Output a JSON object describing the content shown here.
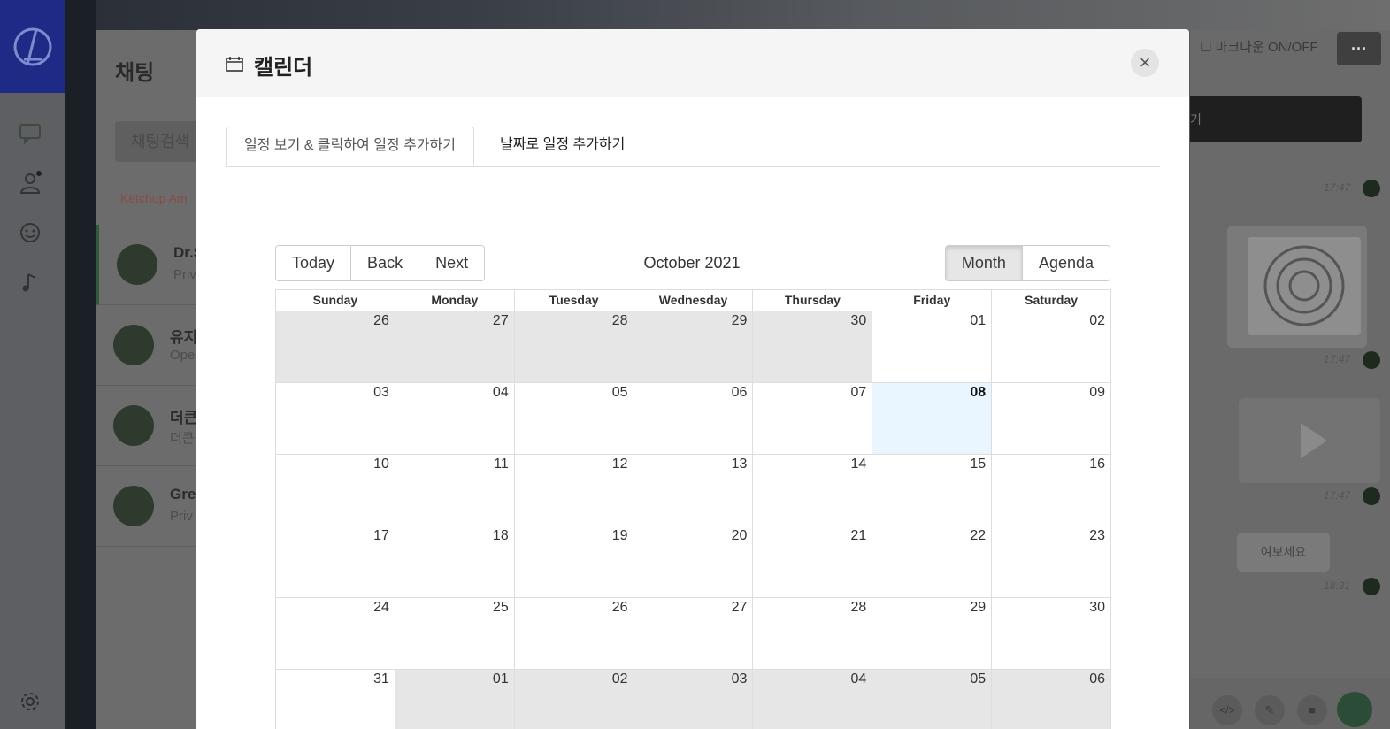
{
  "background": {
    "chat_title": "채팅",
    "chat_search_placeholder": "채팅검색",
    "chat_group_label": "Ketchup Am",
    "chats": [
      {
        "name": "Dr.S",
        "sub": "Priv"
      },
      {
        "name": "유지",
        "sub": "Ope"
      },
      {
        "name": "더큰",
        "sub": "더큰"
      },
      {
        "name": "Gre",
        "sub": "Priv"
      }
    ],
    "markdown_toggle": "마크다운 ON/OFF",
    "more_label": "···",
    "dark_bar_text": "기",
    "timestamps": [
      "17:47",
      "17:47",
      "17:47",
      "18:31"
    ],
    "message_text": "여보세요"
  },
  "modal": {
    "title": "캘린더",
    "close_label": "×",
    "tabs": [
      {
        "label": "일정 보기 & 클릭하여 일정 추가하기",
        "active": true
      },
      {
        "label": "날짜로 일정 추가하기",
        "active": false
      }
    ]
  },
  "calendar": {
    "nav": {
      "today": "Today",
      "back": "Back",
      "next": "Next"
    },
    "label": "October 2021",
    "views": {
      "month": "Month",
      "agenda": "Agenda",
      "active": "Month"
    },
    "weekdays": [
      "Sunday",
      "Monday",
      "Tuesday",
      "Wednesday",
      "Thursday",
      "Friday",
      "Saturday"
    ],
    "weeks": [
      [
        {
          "d": "26",
          "off": true
        },
        {
          "d": "27",
          "off": true
        },
        {
          "d": "28",
          "off": true
        },
        {
          "d": "29",
          "off": true
        },
        {
          "d": "30",
          "off": true
        },
        {
          "d": "01"
        },
        {
          "d": "02"
        }
      ],
      [
        {
          "d": "03"
        },
        {
          "d": "04"
        },
        {
          "d": "05"
        },
        {
          "d": "06"
        },
        {
          "d": "07"
        },
        {
          "d": "08",
          "today": true
        },
        {
          "d": "09"
        }
      ],
      [
        {
          "d": "10"
        },
        {
          "d": "11"
        },
        {
          "d": "12"
        },
        {
          "d": "13"
        },
        {
          "d": "14"
        },
        {
          "d": "15"
        },
        {
          "d": "16"
        }
      ],
      [
        {
          "d": "17"
        },
        {
          "d": "18"
        },
        {
          "d": "19"
        },
        {
          "d": "20"
        },
        {
          "d": "21"
        },
        {
          "d": "22"
        },
        {
          "d": "23"
        }
      ],
      [
        {
          "d": "24"
        },
        {
          "d": "25"
        },
        {
          "d": "26"
        },
        {
          "d": "27"
        },
        {
          "d": "28"
        },
        {
          "d": "29"
        },
        {
          "d": "30"
        }
      ],
      [
        {
          "d": "31"
        },
        {
          "d": "01",
          "off": true
        },
        {
          "d": "02",
          "off": true
        },
        {
          "d": "03",
          "off": true
        },
        {
          "d": "04",
          "off": true
        },
        {
          "d": "05",
          "off": true
        },
        {
          "d": "06",
          "off": true
        }
      ]
    ]
  },
  "colors": {
    "today_bg": "#eaf6ff",
    "off_range_bg": "#e6e6e6",
    "logo_bg": "#1e2a86"
  }
}
